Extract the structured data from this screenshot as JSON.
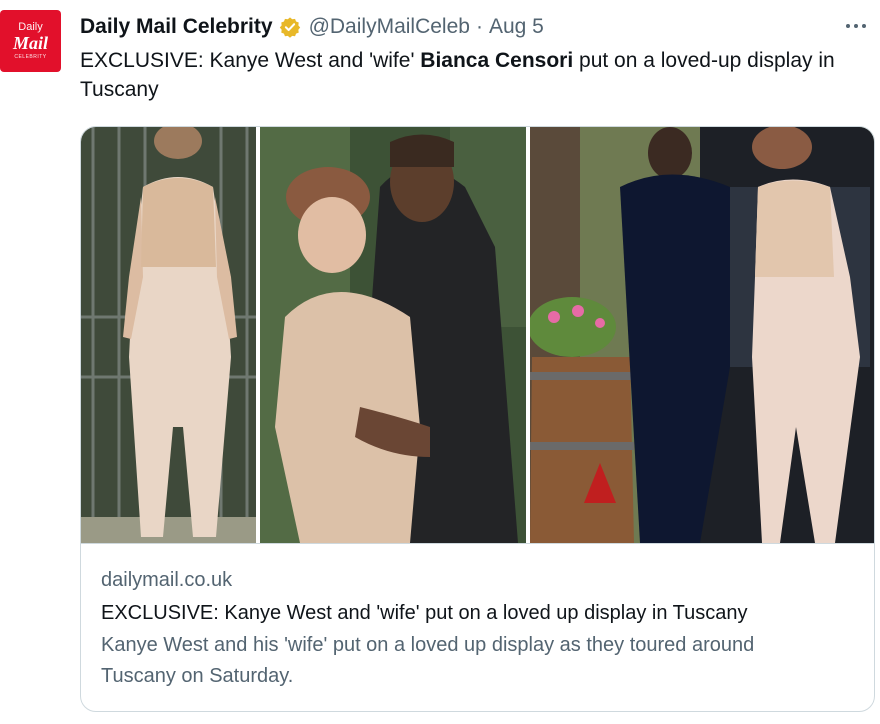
{
  "account": {
    "avatar_line1": "Daily",
    "avatar_line2": "Mail",
    "avatar_line3": "CELEBRITY",
    "name": "Daily Mail Celebrity",
    "handle": "@DailyMailCeleb",
    "separator": "·",
    "date": "Aug 5",
    "verified_badge_icon": "gold-verified-badge-icon"
  },
  "tweet": {
    "text_before": "EXCLUSIVE: Kanye West and 'wife' ",
    "text_bold": "Bianca Censori",
    "text_after": " put on a loved-up display in Tuscany"
  },
  "card": {
    "domain": "dailymail.co.uk",
    "title": "EXCLUSIVE: Kanye West and 'wife' put on a loved up display in Tuscany",
    "description": "Kanye West and his 'wife' put on a loved up display as they toured around Tuscany on Saturday."
  },
  "colors": {
    "brand_red": "#e2102b",
    "secondary_text": "#536471",
    "primary_text": "#0f1419",
    "border": "#cfd9de",
    "badge_gold": "#e8b829"
  }
}
